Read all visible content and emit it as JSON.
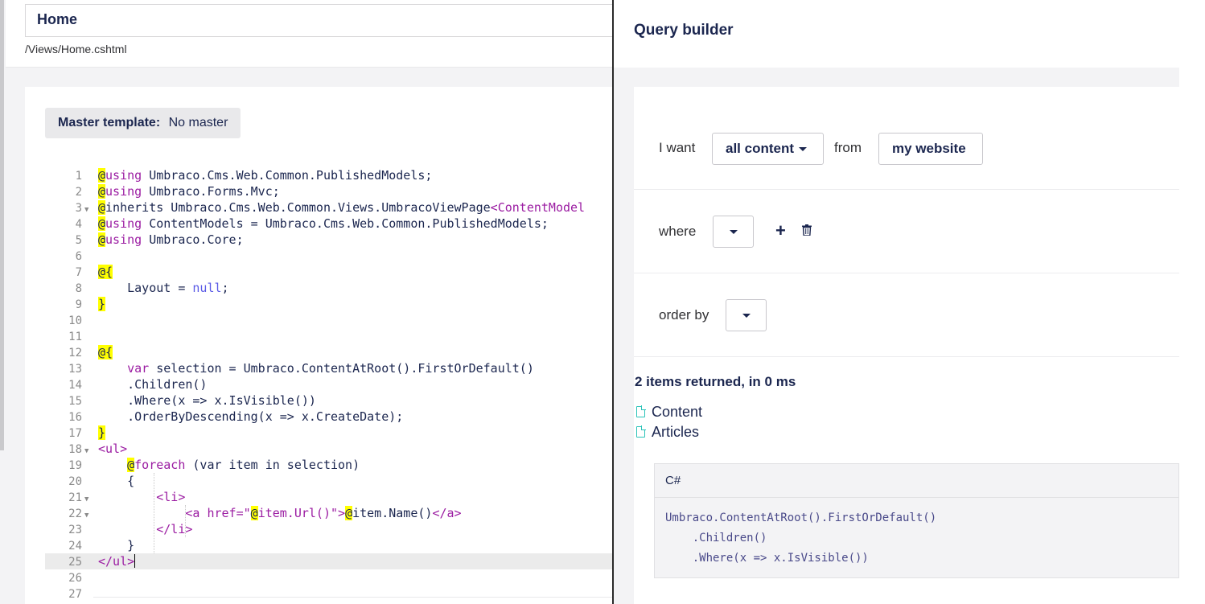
{
  "template": {
    "name": "Home",
    "path": "/Views/Home.cshtml",
    "master_label": "Master template:",
    "master_value": "No master"
  },
  "code_lines": [
    {
      "n": "1",
      "fold": false
    },
    {
      "n": "2",
      "fold": false
    },
    {
      "n": "3",
      "fold": true
    },
    {
      "n": "4",
      "fold": false
    },
    {
      "n": "5",
      "fold": false
    },
    {
      "n": "6",
      "fold": false
    },
    {
      "n": "7",
      "fold": false
    },
    {
      "n": "8",
      "fold": false
    },
    {
      "n": "9",
      "fold": false
    },
    {
      "n": "10",
      "fold": false
    },
    {
      "n": "11",
      "fold": false
    },
    {
      "n": "12",
      "fold": false
    },
    {
      "n": "13",
      "fold": false
    },
    {
      "n": "14",
      "fold": false
    },
    {
      "n": "15",
      "fold": false
    },
    {
      "n": "16",
      "fold": false
    },
    {
      "n": "17",
      "fold": false
    },
    {
      "n": "18",
      "fold": true
    },
    {
      "n": "19",
      "fold": false
    },
    {
      "n": "20",
      "fold": false
    },
    {
      "n": "21",
      "fold": true
    },
    {
      "n": "22",
      "fold": true
    },
    {
      "n": "23",
      "fold": false
    },
    {
      "n": "24",
      "fold": false
    },
    {
      "n": "25",
      "fold": false
    },
    {
      "n": "26",
      "fold": false
    },
    {
      "n": "27",
      "fold": false
    }
  ],
  "code": {
    "l1": [
      "@",
      "using",
      " Umbraco.Cms.Web.Common.PublishedModels;"
    ],
    "l2": [
      "@",
      "using",
      " Umbraco.Forms.Mvc;"
    ],
    "l3": [
      "@",
      "inherits Umbraco.Cms.Web.Common.Views.UmbracoViewPage",
      "<ContentModel"
    ],
    "l4": [
      "@",
      "using",
      " ContentModels = Umbraco.Cms.Web.Common.PublishedModels;"
    ],
    "l5": [
      "@",
      "using",
      " Umbraco.Core;"
    ],
    "l7": "@{",
    "l8a": "    Layout = ",
    "l8b": "null",
    "l8c": ";",
    "l9": "}",
    "l12": "@{",
    "l13a": "    ",
    "l13b": "var",
    "l13c": " selection = Umbraco.ContentAtRoot().FirstOrDefault()",
    "l14": "    .Children()",
    "l15": "    .Where(x => x.IsVisible())",
    "l16": "    .OrderByDescending(x => x.CreateDate);",
    "l17": "}",
    "l18": "<ul>",
    "l19a": "    ",
    "l19b": "@",
    "l19c": "foreach",
    "l19d": " (var item in selection)",
    "l20": "    {",
    "l21": "        <li>",
    "l22a": "            <a ",
    "l22b": "href=",
    "l22c": "\"",
    "l22d": "@",
    "l22e": "item.Url()\">",
    "l22f": "@",
    "l22g": "item.Name()",
    "l22h": "</a>",
    "l23": "        </li>",
    "l24": "    }",
    "l25": "</ul>"
  },
  "query_builder": {
    "title": "Query builder",
    "i_want_label": "I want",
    "content_type": "all content",
    "from_label": "from",
    "source": "my website",
    "where_label": "where",
    "order_by_label": "order by",
    "add_icon": "plus-icon",
    "delete_icon": "trash-icon",
    "results_summary": "2 items returned, in 0 ms",
    "results": [
      "Content",
      "Articles"
    ],
    "result_icon": "document-icon",
    "code_lang": "C#",
    "code_preview": [
      "Umbraco.ContentAtRoot().FirstOrDefault()",
      "    .Children()",
      "    .Where(x => x.IsVisible())"
    ]
  },
  "colors": {
    "accent": "#1b264f",
    "keyword": "#9b1ca2",
    "null_literal": "#5a5ae6",
    "razor_highlight": "#ffff00",
    "document_icon": "#2bc3b9"
  }
}
